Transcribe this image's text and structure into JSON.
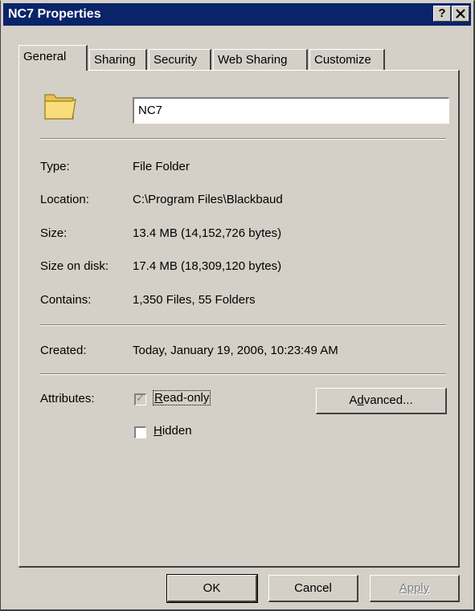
{
  "window": {
    "title": "NC7 Properties",
    "help_label": "?",
    "close_label": "✕"
  },
  "tabs": [
    {
      "label": "General",
      "active": true
    },
    {
      "label": "Sharing",
      "active": false
    },
    {
      "label": "Security",
      "active": false
    },
    {
      "label": "Web Sharing",
      "active": false
    },
    {
      "label": "Customize",
      "active": false
    }
  ],
  "general": {
    "folder_icon": "folder-icon",
    "name_value": "NC7",
    "type_label": "Type:",
    "type_value": "File Folder",
    "location_label": "Location:",
    "location_value": "C:\\Program Files\\Blackbaud",
    "size_label": "Size:",
    "size_value": "13.4 MB (14,152,726 bytes)",
    "size_on_disk_label": "Size on disk:",
    "size_on_disk_value": "17.4 MB (18,309,120 bytes)",
    "contains_label": "Contains:",
    "contains_value": "1,350 Files, 55 Folders",
    "created_label": "Created:",
    "created_value": "Today, January 19, 2006, 10:23:49 AM",
    "attributes_label": "Attributes:",
    "readonly": {
      "label_first": "R",
      "label_rest": "ead-only",
      "checked": true,
      "disabled": true
    },
    "hidden": {
      "label_first": "H",
      "label_rest": "idden",
      "checked": false
    },
    "advanced_first": "Advanced...",
    "advanced_pre": "A",
    "advanced_u": "d",
    "advanced_post": "vanced..."
  },
  "footer": {
    "ok_label": "OK",
    "cancel_label": "Cancel",
    "apply_label": "Apply"
  },
  "colors": {
    "titlebar": "#0a246a",
    "dialog_face": "#d4d0c8",
    "folder": "#f5d46a"
  }
}
